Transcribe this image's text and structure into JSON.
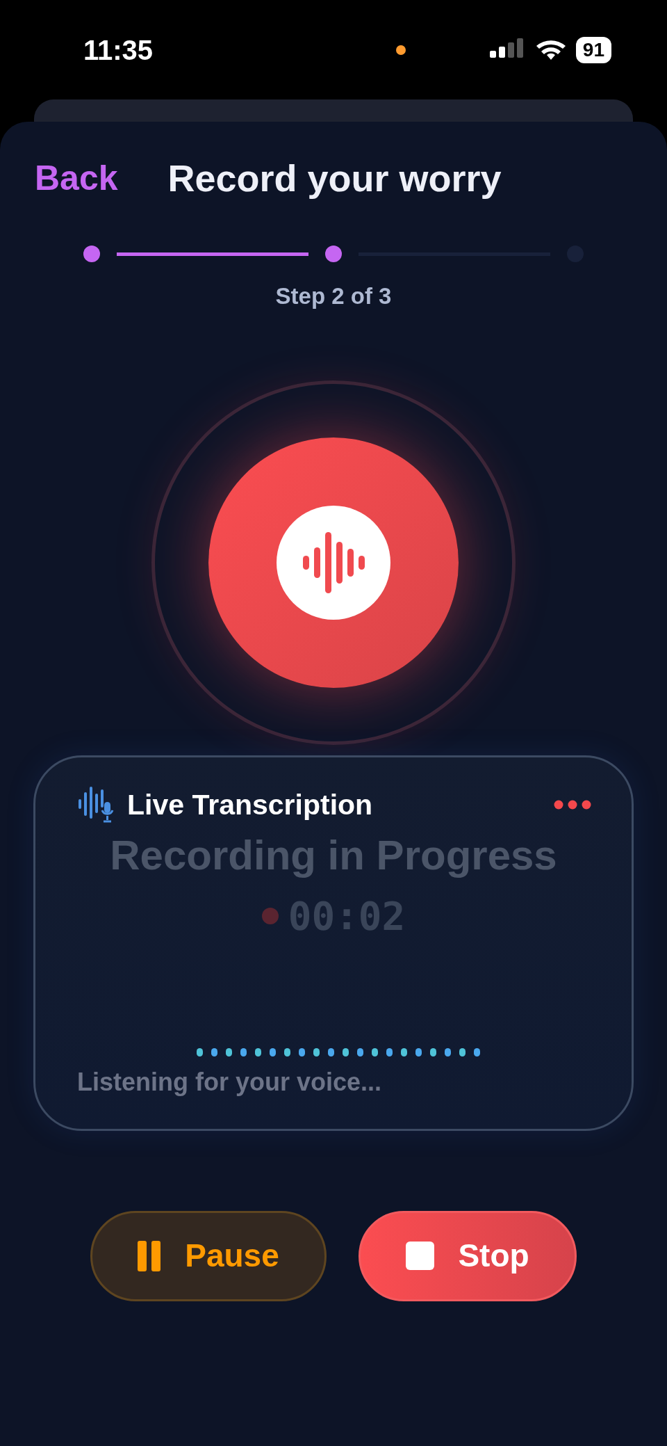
{
  "status_bar": {
    "time": "11:35",
    "battery": "91"
  },
  "header": {
    "back": "Back",
    "title": "Record your worry"
  },
  "stepper": {
    "steps": [
      {
        "reached": true
      },
      {
        "reached": true
      },
      {
        "reached": false
      }
    ],
    "label": "Step 2 of 3"
  },
  "transcription": {
    "title": "Live Transcription",
    "status": "Recording in Progress",
    "timer": "00:02",
    "message": "Listening for your voice..."
  },
  "buttons": [
    {
      "kind": "pause",
      "label": "Pause"
    },
    {
      "kind": "stop",
      "label": "Stop"
    }
  ]
}
